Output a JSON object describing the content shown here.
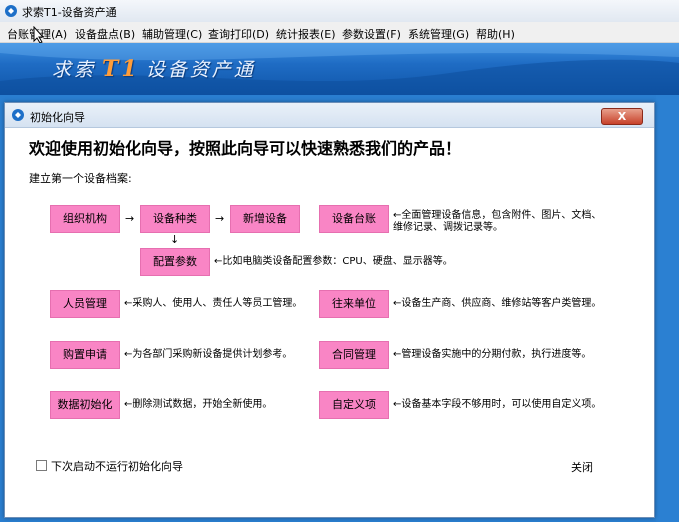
{
  "app": {
    "title": "求索T1-设备资产通"
  },
  "menu": [
    "台账管理(A)",
    "设备盘点(B)",
    "辅助管理(C)",
    "查询打印(D)",
    "统计报表(E)",
    "参数设置(F)",
    "系统管理(G)",
    "帮助(H)"
  ],
  "banner": {
    "prefix": "求索",
    "t1": "T1",
    "suffix": "设备资产通"
  },
  "dialog": {
    "title": "初始化向导",
    "headline": "欢迎使用初始化向导，按照此向导可以快速熟悉我们的产品！",
    "subhead": "建立第一个设备档案:",
    "boxes": {
      "org": "组织机构",
      "type": "设备种类",
      "add": "新增设备",
      "ledger": "设备台账",
      "config": "配置参数",
      "staff": "人员管理",
      "partner": "往来单位",
      "purchase": "购置申请",
      "contract": "合同管理",
      "datainit": "数据初始化",
      "custom": "自定义项"
    },
    "desc": {
      "ledger_1": "←全面管理设备信息，包含附件、图片、文档、",
      "ledger_2": "维修记录、调拨记录等。",
      "config": "←比如电脑类设备配置参数：CPU、硬盘、显示器等。",
      "staff": "←采购人、使用人、责任人等员工管理。",
      "partner": "←设备生产商、供应商、维修站等客户类管理。",
      "purchase": "←为各部门采购新设备提供计划参考。",
      "contract": "←管理设备实施中的分期付款，执行进度等。",
      "datainit": "←删除测试数据，开始全新使用。",
      "custom": "←设备基本字段不够用时，可以使用自定义项。"
    },
    "arrows": {
      "right": "→",
      "down": "↓"
    },
    "checkbox_label": "下次启动不运行初始化向导",
    "close_label": "关闭",
    "close_button": "X"
  }
}
